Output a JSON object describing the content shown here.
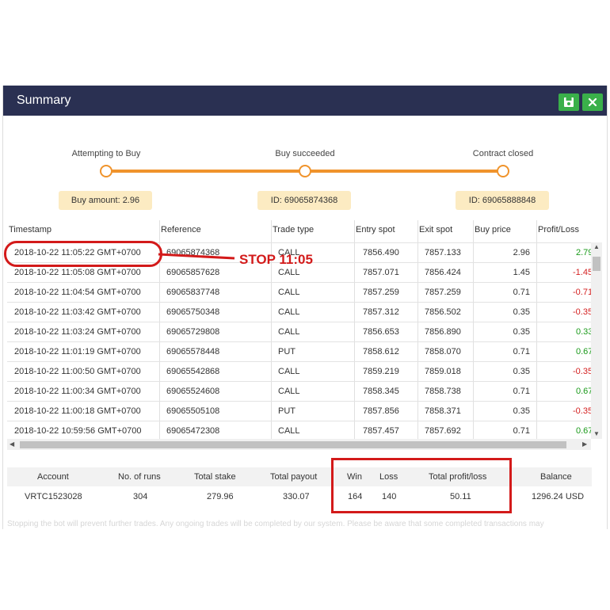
{
  "dialog": {
    "title": "Summary"
  },
  "toolbar": {
    "save_icon": "save-icon",
    "close_icon": "close-icon"
  },
  "steps": [
    {
      "label": "Attempting to Buy",
      "box": "Buy amount: 2.96"
    },
    {
      "label": "Buy succeeded",
      "box": "ID: 69065874368"
    },
    {
      "label": "Contract closed",
      "box": "ID: 69065888848"
    }
  ],
  "table": {
    "headers": [
      "Timestamp",
      "Reference",
      "Trade type",
      "Entry spot",
      "Exit spot",
      "Buy price",
      "Profit/Loss"
    ],
    "rows": [
      {
        "timestamp": "2018-10-22 11:05:22 GMT+0700",
        "reference": "69065874368",
        "type": "CALL",
        "entry": "7856.490",
        "exit": "7857.133",
        "price": "2.96",
        "pl": "2.79",
        "win": true
      },
      {
        "timestamp": "2018-10-22 11:05:08 GMT+0700",
        "reference": "69065857628",
        "type": "CALL",
        "entry": "7857.071",
        "exit": "7856.424",
        "price": "1.45",
        "pl": "-1.45",
        "win": false
      },
      {
        "timestamp": "2018-10-22 11:04:54 GMT+0700",
        "reference": "69065837748",
        "type": "CALL",
        "entry": "7857.259",
        "exit": "7857.259",
        "price": "0.71",
        "pl": "-0.71",
        "win": false
      },
      {
        "timestamp": "2018-10-22 11:03:42 GMT+0700",
        "reference": "69065750348",
        "type": "CALL",
        "entry": "7857.312",
        "exit": "7856.502",
        "price": "0.35",
        "pl": "-0.35",
        "win": false
      },
      {
        "timestamp": "2018-10-22 11:03:24 GMT+0700",
        "reference": "69065729808",
        "type": "CALL",
        "entry": "7856.653",
        "exit": "7856.890",
        "price": "0.35",
        "pl": "0.33",
        "win": true
      },
      {
        "timestamp": "2018-10-22 11:01:19 GMT+0700",
        "reference": "69065578448",
        "type": "PUT",
        "entry": "7858.612",
        "exit": "7858.070",
        "price": "0.71",
        "pl": "0.67",
        "win": true
      },
      {
        "timestamp": "2018-10-22 11:00:50 GMT+0700",
        "reference": "69065542868",
        "type": "CALL",
        "entry": "7859.219",
        "exit": "7859.018",
        "price": "0.35",
        "pl": "-0.35",
        "win": false
      },
      {
        "timestamp": "2018-10-22 11:00:34 GMT+0700",
        "reference": "69065524608",
        "type": "CALL",
        "entry": "7858.345",
        "exit": "7858.738",
        "price": "0.71",
        "pl": "0.67",
        "win": true
      },
      {
        "timestamp": "2018-10-22 11:00:18 GMT+0700",
        "reference": "69065505108",
        "type": "PUT",
        "entry": "7857.856",
        "exit": "7858.371",
        "price": "0.35",
        "pl": "-0.35",
        "win": false
      },
      {
        "timestamp": "2018-10-22 10:59:56 GMT+0700",
        "reference": "69065472308",
        "type": "CALL",
        "entry": "7857.457",
        "exit": "7857.692",
        "price": "0.71",
        "pl": "0.67",
        "win": true
      }
    ]
  },
  "summary": {
    "headers": [
      "Account",
      "No. of runs",
      "Total stake",
      "Total payout",
      "Win",
      "Loss",
      "Total profit/loss",
      "Balance"
    ],
    "values": [
      "VRTC1523028",
      "304",
      "279.96",
      "330.07",
      "164",
      "140",
      "50.11",
      "1296.24 USD"
    ]
  },
  "note": "Stopping the bot will prevent further trades. Any ongoing trades will be completed by our system. Please be aware that some completed transactions may",
  "annotation": {
    "text": "STOP  11:05"
  },
  "colors": {
    "titlebar": "#2a3052",
    "accent": "#f0932b",
    "win": "#1a9a1a",
    "loss": "#d42020",
    "annotation": "#d31a1a"
  }
}
